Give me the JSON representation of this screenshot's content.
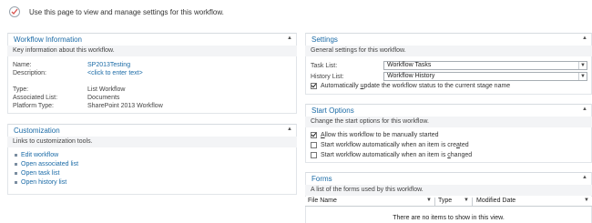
{
  "header": {
    "intro": "Use this page to view and manage settings for this workflow."
  },
  "workflow_info": {
    "title": "Workflow Information",
    "description": "Key information about this workflow.",
    "name_label": "Name:",
    "name_value": "SP2013Testing",
    "desc_label": "Description:",
    "desc_value": "<click to enter text>",
    "type_label": "Type:",
    "type_value": "List Workflow",
    "assoc_label": "Associated List:",
    "assoc_value": "Documents",
    "platform_label": "Platform Type:",
    "platform_value": "SharePoint 2013 Workflow"
  },
  "customization": {
    "title": "Customization",
    "description": "Links to customization tools.",
    "links": [
      "Edit workflow",
      "Open associated list",
      "Open task list",
      "Open history list"
    ]
  },
  "settings": {
    "title": "Settings",
    "description": "General settings for this workflow.",
    "task_label": "Task List:",
    "task_value": "Workflow Tasks",
    "history_label": "History List:",
    "history_value": "Workflow History",
    "auto_update_pre": "Automatically ",
    "auto_update_u": "u",
    "auto_update_post": "pdate the workflow status to the current stage name",
    "auto_update_checked": true
  },
  "start_options": {
    "title": "Start Options",
    "description": "Change the start options for this workflow.",
    "opt1_pre": "",
    "opt1_u": "A",
    "opt1_post": "llow this workflow to be manually started",
    "opt1_checked": true,
    "opt2_pre": "Start workflow automatically when an item is cre",
    "opt2_u": "a",
    "opt2_post": "ted",
    "opt2_checked": false,
    "opt3_pre": "Start workflow automatically when an item is ",
    "opt3_u": "c",
    "opt3_post": "hanged",
    "opt3_checked": false
  },
  "forms": {
    "title": "Forms",
    "description": "A list of the forms used by this workflow.",
    "columns": [
      "File Name",
      "Type",
      "Modified Date"
    ],
    "empty_message": "There are no items to show in this view."
  },
  "icons": {
    "collapse": "collapse-caret-icon",
    "page": "workflow-settings-icon",
    "sort": "column-dropdown-icon"
  }
}
